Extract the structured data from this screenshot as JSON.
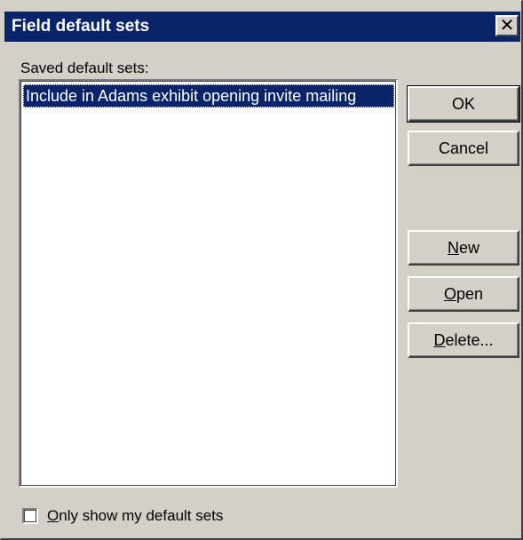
{
  "dialog": {
    "title": "Field default sets",
    "close_glyph": "✕",
    "close_icon": "close-icon"
  },
  "list": {
    "label": "Saved default sets:",
    "items": [
      {
        "label": "Include in Adams exhibit opening invite mailing",
        "selected": true
      }
    ]
  },
  "buttons": {
    "ok": "OK",
    "cancel": "Cancel",
    "new_mnemonic": "N",
    "new_rest": "ew",
    "open_mnemonic": "O",
    "open_rest": "pen",
    "delete_mnemonic": "D",
    "delete_rest": "elete..."
  },
  "filter": {
    "checked": false,
    "label_mnemonic": "O",
    "label_rest": "nly show my default sets"
  },
  "colors": {
    "titlebar": "#0a246a",
    "dialog_face": "#d4d0c8",
    "selection": "#0a246a"
  }
}
